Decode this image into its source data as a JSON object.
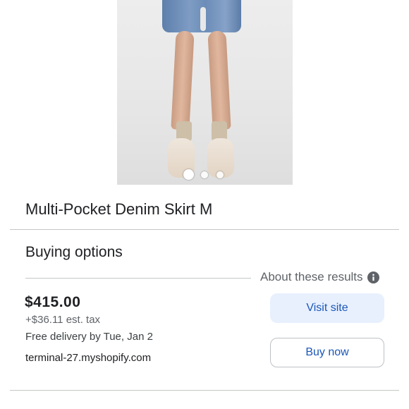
{
  "product": {
    "title": "Multi-Pocket Denim Skirt M",
    "image_alt": "Product photo",
    "carousel": {
      "total": 3,
      "active_index": 0
    }
  },
  "buying_options": {
    "heading": "Buying options",
    "about_label": "About these results",
    "info_icon": "info-icon"
  },
  "offer": {
    "price": "$415.00",
    "tax": "+$36.11 est. tax",
    "delivery": "Free delivery by Tue, Jan 2",
    "store": "terminal-27.myshopify.com",
    "visit_label": "Visit site",
    "buy_label": "Buy now"
  },
  "colors": {
    "primary_button_bg": "#e8f0fe",
    "link_blue": "#1a56b8",
    "text_primary": "#202124",
    "text_secondary": "#5f6368"
  }
}
